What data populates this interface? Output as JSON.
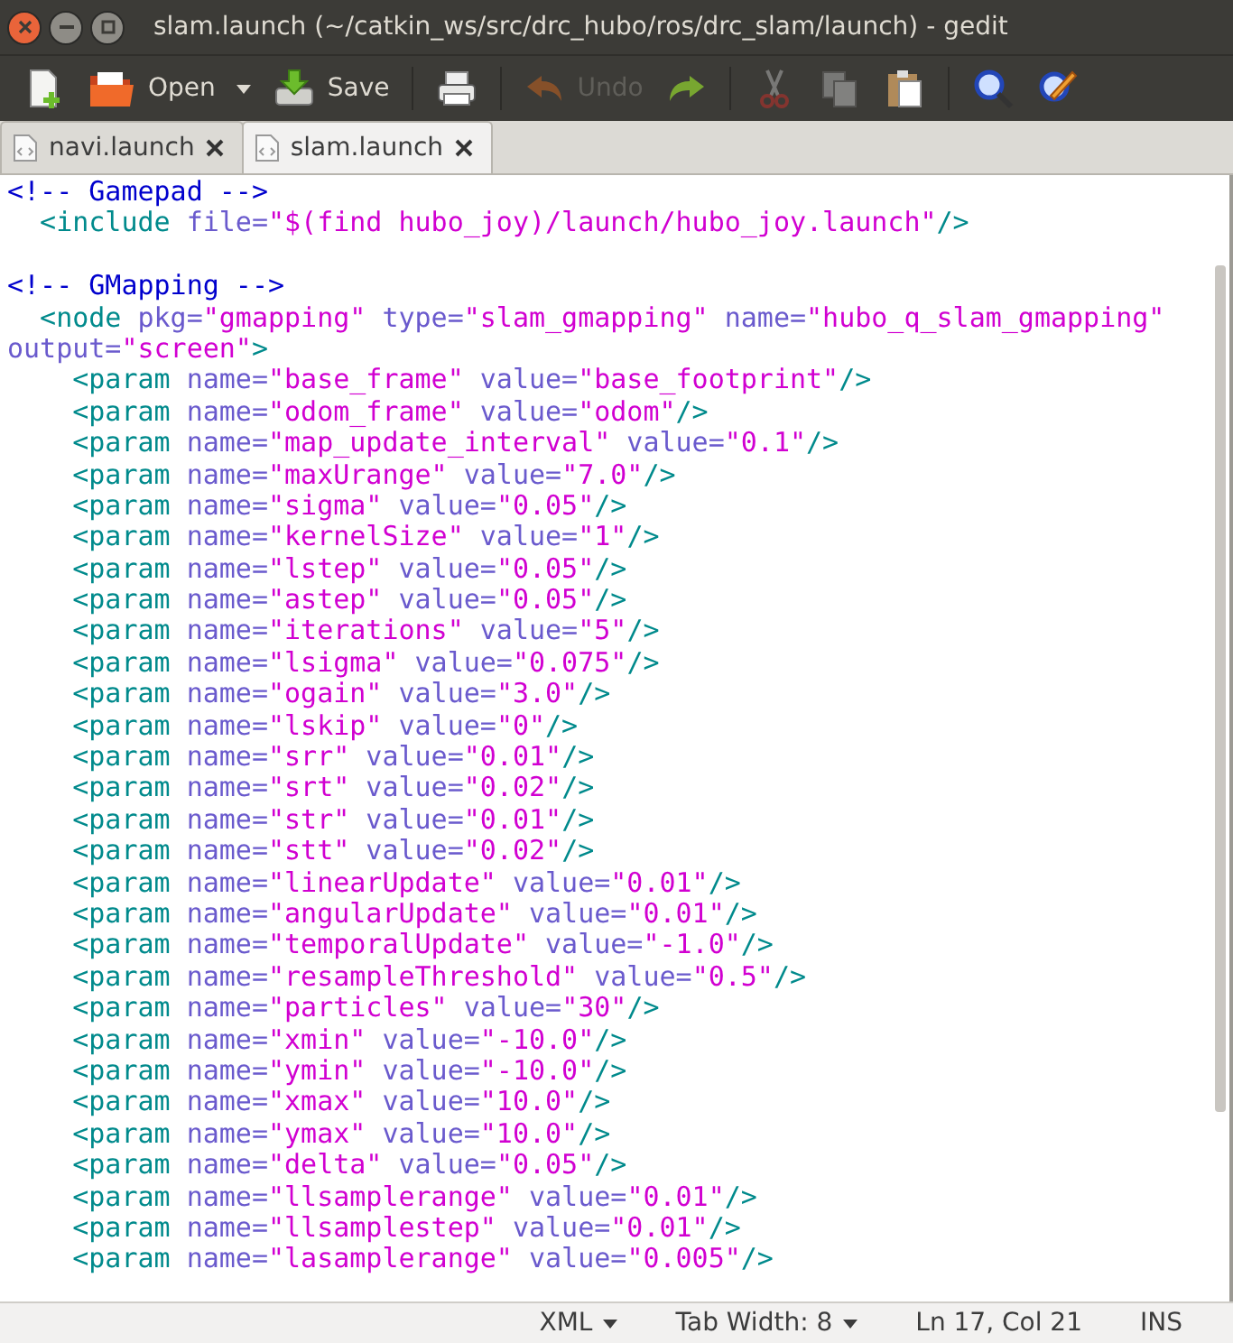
{
  "window": {
    "title": "slam.launch (~/catkin_ws/src/drc_hubo/ros/drc_slam/launch) - gedit"
  },
  "toolbar": [
    {
      "kind": "new",
      "disabled": false
    },
    {
      "kind": "open",
      "label": "Open",
      "disabled": false
    },
    {
      "kind": "dropdown",
      "disabled": false
    },
    {
      "kind": "save",
      "label": "Save",
      "disabled": false
    },
    {
      "kind": "print",
      "disabled": false
    },
    {
      "kind": "undo",
      "label": "Undo",
      "disabled": true
    },
    {
      "kind": "redo",
      "disabled": false
    },
    {
      "kind": "cut",
      "disabled": true
    },
    {
      "kind": "copy",
      "disabled": true
    },
    {
      "kind": "paste",
      "disabled": false
    },
    {
      "kind": "search",
      "disabled": false
    },
    {
      "kind": "replace",
      "disabled": false
    }
  ],
  "tabs": [
    {
      "label": "navi.launch",
      "selected": false
    },
    {
      "label": "slam.launch",
      "selected": true
    }
  ],
  "editor": {
    "lines": [
      [
        {
          "kind": "comment",
          "text": "<!-- Gamepad -->"
        }
      ],
      [
        {
          "kind": "tag",
          "text": "  <include"
        },
        {
          "kind": "attr",
          "text": " file="
        },
        {
          "kind": "value",
          "text": "\"$(find hubo_joy)/launch/hubo_joy.launch\""
        },
        {
          "kind": "tag",
          "text": "/>"
        }
      ],
      {
        "kind": "blank"
      },
      [
        {
          "kind": "comment",
          "text": "<!-- GMapping -->"
        }
      ],
      [
        {
          "kind": "tag",
          "text": "  <node"
        },
        {
          "kind": "attr",
          "text": " pkg="
        },
        {
          "kind": "value",
          "text": "\"gmapping\""
        },
        {
          "kind": "attr",
          "text": " type="
        },
        {
          "kind": "value",
          "text": "\"slam_gmapping\""
        },
        {
          "kind": "attr",
          "text": " name="
        },
        {
          "kind": "value",
          "text": "\"hubo_q_slam_gmapping\""
        }
      ],
      [
        {
          "kind": "attr",
          "text": "output="
        },
        {
          "kind": "value",
          "text": "\"screen\""
        },
        {
          "kind": "tag",
          "text": ">"
        }
      ],
      [
        {
          "kind": "tag",
          "text": "    <param"
        },
        {
          "kind": "attr",
          "text": " name="
        },
        {
          "kind": "value",
          "text": "\"base_frame\""
        },
        {
          "kind": "attr",
          "text": " value="
        },
        {
          "kind": "value",
          "text": "\"base_footprint\""
        },
        {
          "kind": "tag",
          "text": "/>"
        }
      ],
      [
        {
          "kind": "tag",
          "text": "    <param"
        },
        {
          "kind": "attr",
          "text": " name="
        },
        {
          "kind": "value",
          "text": "\"odom_frame\""
        },
        {
          "kind": "attr",
          "text": " value="
        },
        {
          "kind": "value",
          "text": "\"odom\""
        },
        {
          "kind": "tag",
          "text": "/>"
        }
      ],
      [
        {
          "kind": "tag",
          "text": "    <param"
        },
        {
          "kind": "attr",
          "text": " name="
        },
        {
          "kind": "value",
          "text": "\"map_update_interval\""
        },
        {
          "kind": "attr",
          "text": " value="
        },
        {
          "kind": "value",
          "text": "\"0.1\""
        },
        {
          "kind": "tag",
          "text": "/>"
        }
      ],
      [
        {
          "kind": "tag",
          "text": "    <param"
        },
        {
          "kind": "attr",
          "text": " name="
        },
        {
          "kind": "value",
          "text": "\"maxUrange\""
        },
        {
          "kind": "attr",
          "text": " value="
        },
        {
          "kind": "value",
          "text": "\"7.0\""
        },
        {
          "kind": "tag",
          "text": "/>"
        }
      ],
      [
        {
          "kind": "tag",
          "text": "    <param"
        },
        {
          "kind": "attr",
          "text": " name="
        },
        {
          "kind": "value",
          "text": "\"sigma\""
        },
        {
          "kind": "attr",
          "text": " value="
        },
        {
          "kind": "value",
          "text": "\"0.05\""
        },
        {
          "kind": "tag",
          "text": "/>"
        }
      ],
      [
        {
          "kind": "tag",
          "text": "    <param"
        },
        {
          "kind": "attr",
          "text": " name="
        },
        {
          "kind": "value",
          "text": "\"kernelSize\""
        },
        {
          "kind": "attr",
          "text": " value="
        },
        {
          "kind": "value",
          "text": "\"1\""
        },
        {
          "kind": "tag",
          "text": "/>"
        }
      ],
      [
        {
          "kind": "tag",
          "text": "    <param"
        },
        {
          "kind": "attr",
          "text": " name="
        },
        {
          "kind": "value",
          "text": "\"lstep\""
        },
        {
          "kind": "attr",
          "text": " value="
        },
        {
          "kind": "value",
          "text": "\"0.05\""
        },
        {
          "kind": "tag",
          "text": "/>"
        }
      ],
      [
        {
          "kind": "tag",
          "text": "    <param"
        },
        {
          "kind": "attr",
          "text": " name="
        },
        {
          "kind": "value",
          "text": "\"astep\""
        },
        {
          "kind": "attr",
          "text": " value="
        },
        {
          "kind": "value",
          "text": "\"0.05\""
        },
        {
          "kind": "tag",
          "text": "/>"
        }
      ],
      [
        {
          "kind": "tag",
          "text": "    <param"
        },
        {
          "kind": "attr",
          "text": " name="
        },
        {
          "kind": "value",
          "text": "\"iterations\""
        },
        {
          "kind": "attr",
          "text": " value="
        },
        {
          "kind": "value",
          "text": "\"5\""
        },
        {
          "kind": "tag",
          "text": "/>"
        }
      ],
      [
        {
          "kind": "tag",
          "text": "    <param"
        },
        {
          "kind": "attr",
          "text": " name="
        },
        {
          "kind": "value",
          "text": "\"lsigma\""
        },
        {
          "kind": "attr",
          "text": " value="
        },
        {
          "kind": "value",
          "text": "\"0.075\""
        },
        {
          "kind": "tag",
          "text": "/>"
        }
      ],
      [
        {
          "kind": "tag",
          "text": "    <param"
        },
        {
          "kind": "attr",
          "text": " name="
        },
        {
          "kind": "value",
          "text": "\"ogain\""
        },
        {
          "kind": "attr",
          "text": " value="
        },
        {
          "kind": "value",
          "text": "\"3.0\""
        },
        {
          "kind": "tag",
          "text": "/>"
        }
      ],
      [
        {
          "kind": "tag",
          "text": "    <param"
        },
        {
          "kind": "attr",
          "text": " name="
        },
        {
          "kind": "value",
          "text": "\"lskip\""
        },
        {
          "kind": "attr",
          "text": " value="
        },
        {
          "kind": "value",
          "text": "\"0\""
        },
        {
          "kind": "tag",
          "text": "/>"
        }
      ],
      [
        {
          "kind": "tag",
          "text": "    <param"
        },
        {
          "kind": "attr",
          "text": " name="
        },
        {
          "kind": "value",
          "text": "\"srr\""
        },
        {
          "kind": "attr",
          "text": " value="
        },
        {
          "kind": "value",
          "text": "\"0.01\""
        },
        {
          "kind": "tag",
          "text": "/>"
        }
      ],
      [
        {
          "kind": "tag",
          "text": "    <param"
        },
        {
          "kind": "attr",
          "text": " name="
        },
        {
          "kind": "value",
          "text": "\"srt\""
        },
        {
          "kind": "attr",
          "text": " value="
        },
        {
          "kind": "value",
          "text": "\"0.02\""
        },
        {
          "kind": "tag",
          "text": "/>"
        }
      ],
      [
        {
          "kind": "tag",
          "text": "    <param"
        },
        {
          "kind": "attr",
          "text": " name="
        },
        {
          "kind": "value",
          "text": "\"str\""
        },
        {
          "kind": "attr",
          "text": " value="
        },
        {
          "kind": "value",
          "text": "\"0.01\""
        },
        {
          "kind": "tag",
          "text": "/>"
        }
      ],
      [
        {
          "kind": "tag",
          "text": "    <param"
        },
        {
          "kind": "attr",
          "text": " name="
        },
        {
          "kind": "value",
          "text": "\"stt\""
        },
        {
          "kind": "attr",
          "text": " value="
        },
        {
          "kind": "value",
          "text": "\"0.02\""
        },
        {
          "kind": "tag",
          "text": "/>"
        }
      ],
      [
        {
          "kind": "tag",
          "text": "    <param"
        },
        {
          "kind": "attr",
          "text": " name="
        },
        {
          "kind": "value",
          "text": "\"linearUpdate\""
        },
        {
          "kind": "attr",
          "text": " value="
        },
        {
          "kind": "value",
          "text": "\"0.01\""
        },
        {
          "kind": "tag",
          "text": "/>"
        }
      ],
      [
        {
          "kind": "tag",
          "text": "    <param"
        },
        {
          "kind": "attr",
          "text": " name="
        },
        {
          "kind": "value",
          "text": "\"angularUpdate\""
        },
        {
          "kind": "attr",
          "text": " value="
        },
        {
          "kind": "value",
          "text": "\"0.01\""
        },
        {
          "kind": "tag",
          "text": "/>"
        }
      ],
      [
        {
          "kind": "tag",
          "text": "    <param"
        },
        {
          "kind": "attr",
          "text": " name="
        },
        {
          "kind": "value",
          "text": "\"temporalUpdate\""
        },
        {
          "kind": "attr",
          "text": " value="
        },
        {
          "kind": "value",
          "text": "\"-1.0\""
        },
        {
          "kind": "tag",
          "text": "/>"
        }
      ],
      [
        {
          "kind": "tag",
          "text": "    <param"
        },
        {
          "kind": "attr",
          "text": " name="
        },
        {
          "kind": "value",
          "text": "\"resampleThreshold\""
        },
        {
          "kind": "attr",
          "text": " value="
        },
        {
          "kind": "value",
          "text": "\"0.5\""
        },
        {
          "kind": "tag",
          "text": "/>"
        }
      ],
      [
        {
          "kind": "tag",
          "text": "    <param"
        },
        {
          "kind": "attr",
          "text": " name="
        },
        {
          "kind": "value",
          "text": "\"particles\""
        },
        {
          "kind": "attr",
          "text": " value="
        },
        {
          "kind": "value",
          "text": "\"30\""
        },
        {
          "kind": "tag",
          "text": "/>"
        }
      ],
      [
        {
          "kind": "tag",
          "text": "    <param"
        },
        {
          "kind": "attr",
          "text": " name="
        },
        {
          "kind": "value",
          "text": "\"xmin\""
        },
        {
          "kind": "attr",
          "text": " value="
        },
        {
          "kind": "value",
          "text": "\"-10.0\""
        },
        {
          "kind": "tag",
          "text": "/>"
        }
      ],
      [
        {
          "kind": "tag",
          "text": "    <param"
        },
        {
          "kind": "attr",
          "text": " name="
        },
        {
          "kind": "value",
          "text": "\"ymin\""
        },
        {
          "kind": "attr",
          "text": " value="
        },
        {
          "kind": "value",
          "text": "\"-10.0\""
        },
        {
          "kind": "tag",
          "text": "/>"
        }
      ],
      [
        {
          "kind": "tag",
          "text": "    <param"
        },
        {
          "kind": "attr",
          "text": " name="
        },
        {
          "kind": "value",
          "text": "\"xmax\""
        },
        {
          "kind": "attr",
          "text": " value="
        },
        {
          "kind": "value",
          "text": "\"10.0\""
        },
        {
          "kind": "tag",
          "text": "/>"
        }
      ],
      [
        {
          "kind": "tag",
          "text": "    <param"
        },
        {
          "kind": "attr",
          "text": " name="
        },
        {
          "kind": "value",
          "text": "\"ymax\""
        },
        {
          "kind": "attr",
          "text": " value="
        },
        {
          "kind": "value",
          "text": "\"10.0\""
        },
        {
          "kind": "tag",
          "text": "/>"
        }
      ],
      [
        {
          "kind": "tag",
          "text": "    <param"
        },
        {
          "kind": "attr",
          "text": " name="
        },
        {
          "kind": "value",
          "text": "\"delta\""
        },
        {
          "kind": "attr",
          "text": " value="
        },
        {
          "kind": "value",
          "text": "\"0.05\""
        },
        {
          "kind": "tag",
          "text": "/>"
        }
      ],
      [
        {
          "kind": "tag",
          "text": "    <param"
        },
        {
          "kind": "attr",
          "text": " name="
        },
        {
          "kind": "value",
          "text": "\"llsamplerange\""
        },
        {
          "kind": "attr",
          "text": " value="
        },
        {
          "kind": "value",
          "text": "\"0.01\""
        },
        {
          "kind": "tag",
          "text": "/>"
        }
      ],
      [
        {
          "kind": "tag",
          "text": "    <param"
        },
        {
          "kind": "attr",
          "text": " name="
        },
        {
          "kind": "value",
          "text": "\"llsamplestep\""
        },
        {
          "kind": "attr",
          "text": " value="
        },
        {
          "kind": "value",
          "text": "\"0.01\""
        },
        {
          "kind": "tag",
          "text": "/>"
        }
      ],
      [
        {
          "kind": "tag",
          "text": "    <param"
        },
        {
          "kind": "attr",
          "text": " name="
        },
        {
          "kind": "value",
          "text": "\"lasamplerange\""
        },
        {
          "kind": "attr",
          "text": " value="
        },
        {
          "kind": "value",
          "text": "\"0.005\""
        },
        {
          "kind": "tag",
          "text": "/>"
        }
      ]
    ]
  },
  "status_bar": {
    "language": "XML",
    "tab_width": "Tab Width: 8",
    "position": "Ln 17, Col 21",
    "mode": "INS"
  }
}
